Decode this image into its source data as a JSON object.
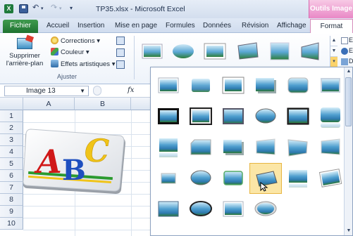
{
  "titlebar": {
    "app_icon_label": "X",
    "undo_glyph": "↶",
    "redo_glyph": "↷",
    "qat_dropdown_glyph": "▾",
    "document_title": "TP35.xlsx - Microsoft Excel",
    "context_header": "Outils Image"
  },
  "tabs": [
    {
      "label": "Fichier"
    },
    {
      "label": "Accueil"
    },
    {
      "label": "Insertion"
    },
    {
      "label": "Mise en page"
    },
    {
      "label": "Formules"
    },
    {
      "label": "Données"
    },
    {
      "label": "Révision"
    },
    {
      "label": "Affichage"
    },
    {
      "label": "Format"
    }
  ],
  "ribbon": {
    "remove_background": "Supprimer l'arrière-plan",
    "corrections": "Corrections ▾",
    "color": "Couleur ▾",
    "artistic_effects": "Effets artistiques ▾",
    "group_adjust": "Ajuster",
    "right_cut_1": "E",
    "right_cut_2": "E",
    "right_cut_3": "D"
  },
  "formula_bar": {
    "name_box": "Image 13",
    "fx": "fx"
  },
  "grid": {
    "columns": [
      "A",
      "B"
    ],
    "rows": [
      "1",
      "2",
      "3",
      "4",
      "5",
      "6",
      "7",
      "8",
      "9",
      "10"
    ]
  },
  "picture": {
    "letters": [
      "A",
      "B",
      "C"
    ],
    "letter_colors": [
      "#d01818",
      "#1e4fbf",
      "#f0c419"
    ],
    "accent_green": "#2b9a2f"
  },
  "gallery": {
    "selected_index": 21,
    "styles": [
      "Cadre simple, blanc",
      "Biseau doux",
      "Cadre épais, blanc",
      "Rectangle à ombre portée",
      "Rectangle à bords arrondis",
      "Bord en relief",
      "Cadre noir, double",
      "Cadre métallique",
      "Ombre intérieure douce",
      "Ellipse à bords adoucis",
      "Cadre épais, noir",
      "Rectangle à coins arrondis réfléchi",
      "Rectangle arrondi réfléchi",
      "Rectangle à coins coupés",
      "Rectangle avec ombre",
      "Perspective douce",
      "Perspective vers la gauche",
      "Perspective vers la droite",
      "Cadre en relief",
      "Ovale réfléchi",
      "Biseau rectangulaire",
      "Perspective relief",
      "Perspective réfléchie",
      "Rotation, blanc",
      "Cadre moderne métallique",
      "Ovale en relief, noir",
      "Rectangle en relief",
      "Ovale métallique"
    ]
  },
  "colors": {
    "excel_green": "#1f7331",
    "picture_tools_pink": "#e988c6",
    "hover_highlight": "#fbe6a6"
  }
}
